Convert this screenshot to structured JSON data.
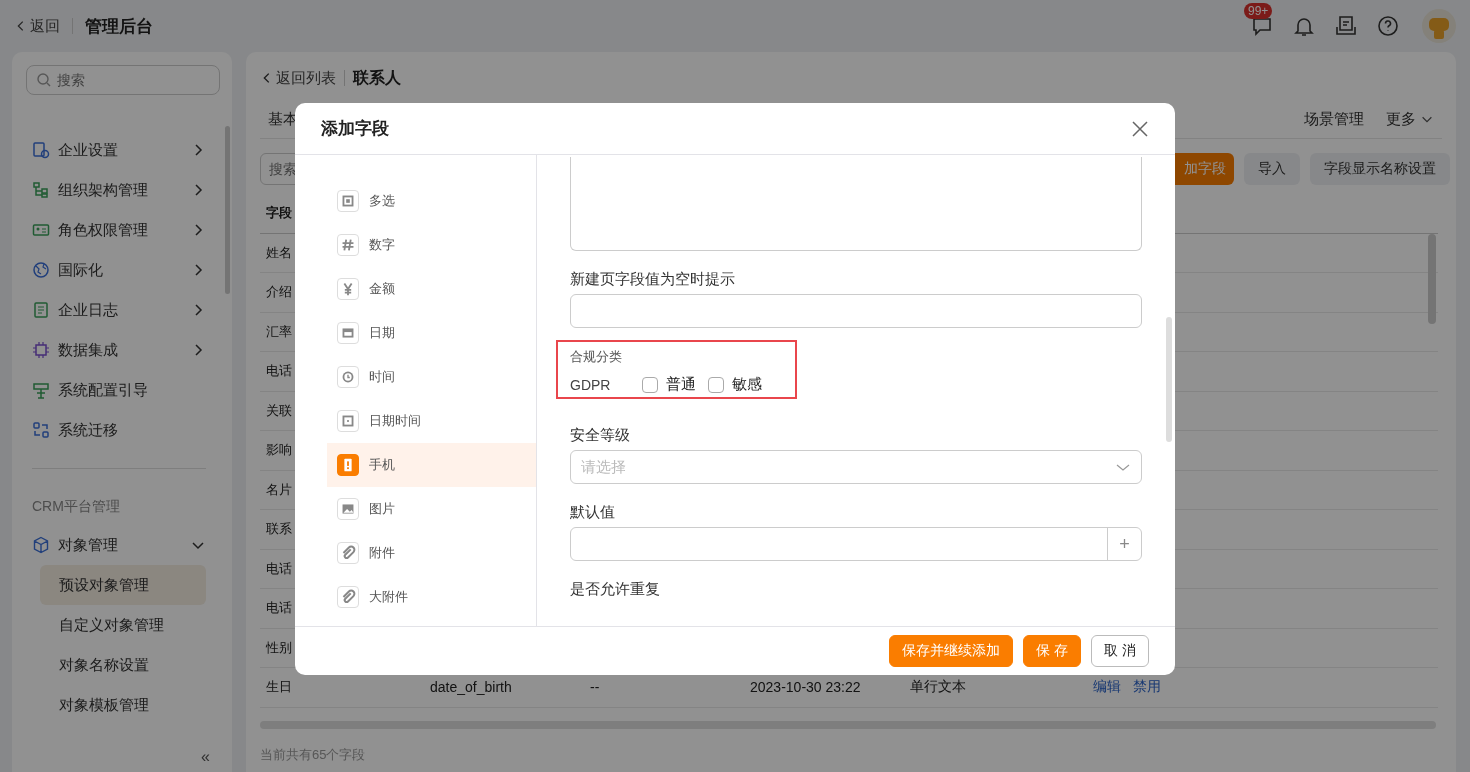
{
  "topbar": {
    "back": "返回",
    "title": "管理后台",
    "badge": "99+"
  },
  "sidebar": {
    "search_placeholder": "搜索",
    "items": [
      {
        "label": "企业设置",
        "expandable": true
      },
      {
        "label": "组织架构管理",
        "expandable": true
      },
      {
        "label": "角色权限管理",
        "expandable": true
      },
      {
        "label": "国际化",
        "expandable": true
      },
      {
        "label": "企业日志",
        "expandable": true
      },
      {
        "label": "数据集成",
        "expandable": true
      },
      {
        "label": "系统配置引导",
        "expandable": false
      },
      {
        "label": "系统迁移",
        "expandable": false
      }
    ],
    "section": "CRM平台管理",
    "group": {
      "label": "对象管理",
      "expanded": true,
      "children": [
        {
          "label": "预设对象管理",
          "selected": true
        },
        {
          "label": "自定义对象管理",
          "selected": false
        },
        {
          "label": "对象名称设置",
          "selected": false
        },
        {
          "label": "对象模板管理",
          "selected": false
        }
      ]
    },
    "collapse": "«"
  },
  "main": {
    "back": "返回列表",
    "title": "联系人",
    "tabs": [
      "基本",
      "场景管理"
    ],
    "more": "更多",
    "search_placeholder": "搜索",
    "buttons": [
      {
        "label": "加字段",
        "primary": true
      },
      {
        "label": "导入",
        "primary": false
      },
      {
        "label": "字段显示名称设置",
        "primary": false
      }
    ],
    "table": {
      "header": "字段",
      "rows": [
        {
          "cells": [
            "姓名"
          ]
        },
        {
          "cells": [
            "介绍"
          ]
        },
        {
          "cells": [
            "汇率"
          ]
        },
        {
          "cells": [
            "电话"
          ]
        },
        {
          "cells": [
            "关联"
          ]
        },
        {
          "cells": [
            "影响"
          ]
        },
        {
          "cells": [
            "名片"
          ]
        },
        {
          "cells": [
            "联系"
          ]
        },
        {
          "cells": [
            "电话"
          ]
        },
        {
          "cells": [
            "电话"
          ]
        },
        {
          "cells": [
            "性别"
          ]
        },
        {
          "cells": [
            "生日",
            "date_of_birth",
            "--",
            "2023-10-30 23:22",
            "单行文本"
          ],
          "actions": [
            "编辑",
            "禁用"
          ]
        }
      ]
    },
    "footer": "当前共有65个字段"
  },
  "dialog": {
    "title": "添加字段",
    "types": [
      {
        "label": "多选",
        "selected": false
      },
      {
        "label": "数字",
        "selected": false
      },
      {
        "label": "金额",
        "selected": false
      },
      {
        "label": "日期",
        "selected": false
      },
      {
        "label": "时间",
        "selected": false
      },
      {
        "label": "日期时间",
        "selected": false
      },
      {
        "label": "手机",
        "selected": true
      },
      {
        "label": "图片",
        "selected": false
      },
      {
        "label": "附件",
        "selected": false
      },
      {
        "label": "大附件",
        "selected": false
      }
    ],
    "empty_hint_label": "新建页字段值为空时提示",
    "compliance": {
      "label": "合规分类",
      "name": "GDPR",
      "options": [
        {
          "label": "普通",
          "checked": false
        },
        {
          "label": "敏感",
          "checked": false
        }
      ]
    },
    "security_label": "安全等级",
    "security_placeholder": "请选择",
    "default_label": "默认值",
    "default_add": "+",
    "duplicate_label": "是否允许重复",
    "buttons": [
      {
        "label": "保存并继续添加",
        "primary": true
      },
      {
        "label": "保 存",
        "primary": true
      },
      {
        "label": "取 消",
        "primary": false
      }
    ]
  }
}
